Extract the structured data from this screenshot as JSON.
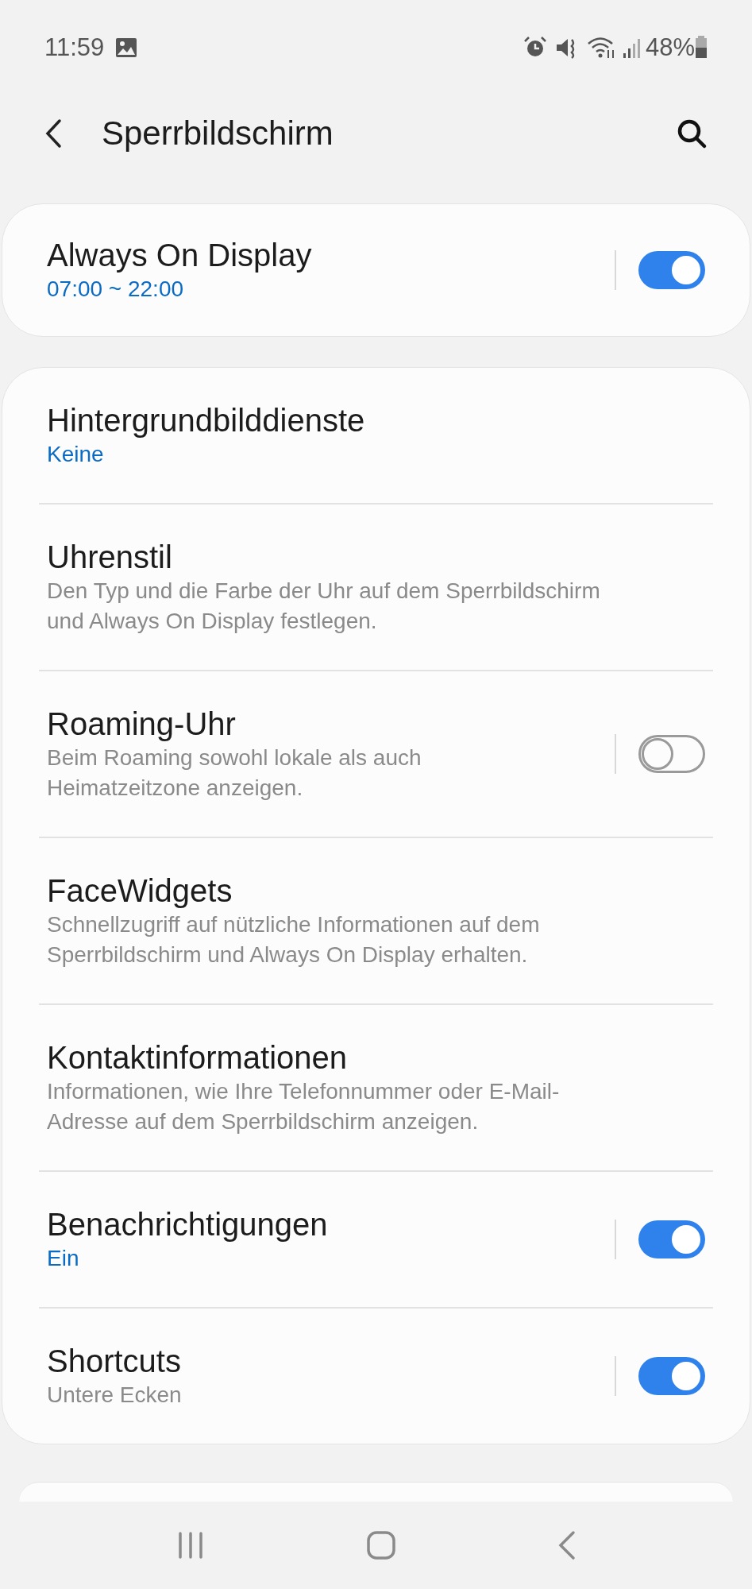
{
  "status_bar": {
    "time": "11:59",
    "battery_percent": "48%"
  },
  "header": {
    "title": "Sperrbildschirm"
  },
  "top_card": {
    "title": "Always On Display",
    "summary": "07:00 ~ 22:00",
    "accent": true,
    "on": true
  },
  "settings": [
    {
      "title": "Hintergrundbilddienste",
      "summary": "Keine",
      "accent": true,
      "kind": "link"
    },
    {
      "title": "Uhrenstil",
      "summary": "Den Typ und die Farbe der Uhr auf dem Sperrbildschirm und Always On Display festlegen.",
      "accent": false,
      "kind": "link"
    },
    {
      "title": "Roaming-Uhr",
      "summary": "Beim Roaming sowohl lokale als auch Heimatzeitzone anzeigen.",
      "accent": false,
      "kind": "switch",
      "on": false
    },
    {
      "title": "FaceWidgets",
      "summary": "Schnellzugriff auf nützliche Informationen auf dem Sperrbildschirm und Always On Display erhalten.",
      "accent": false,
      "kind": "link"
    },
    {
      "title": "Kontaktinformationen",
      "summary": "Informationen, wie Ihre Telefonnummer oder E-Mail-Adresse auf dem Sperrbildschirm anzeigen.",
      "accent": false,
      "kind": "link"
    },
    {
      "title": "Benachrichtigungen",
      "summary": "Ein",
      "accent": true,
      "kind": "switch",
      "on": true
    },
    {
      "title": "Shortcuts",
      "summary": "Untere Ecken",
      "accent": false,
      "kind": "switch",
      "on": true
    }
  ]
}
